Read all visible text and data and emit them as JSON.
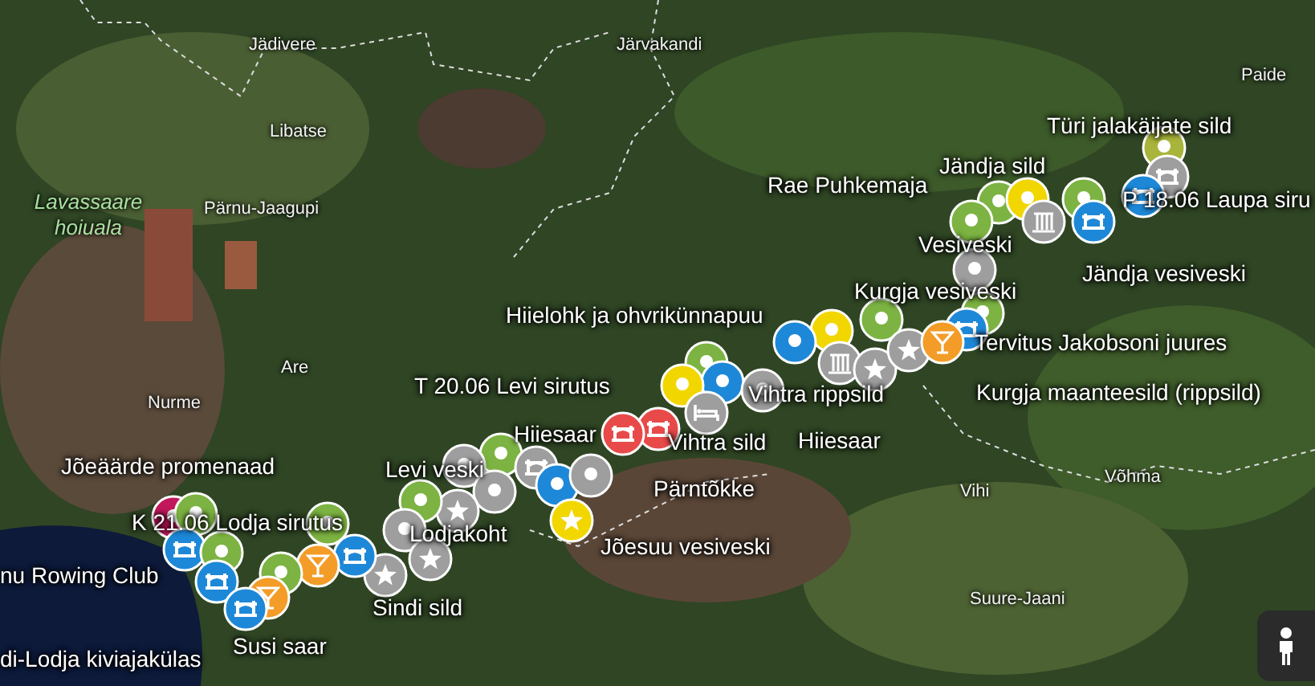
{
  "map": {
    "place_names": [
      {
        "text": "Jädivere",
        "kind": "town"
      },
      {
        "text": "Järvakandi",
        "kind": "town"
      },
      {
        "text": "Paide",
        "kind": "town"
      },
      {
        "text": "Libatse",
        "kind": "town"
      },
      {
        "text": "Lavassaare hoiuala",
        "kind": "area"
      },
      {
        "text": "Pärnu-Jaagupi",
        "kind": "town"
      },
      {
        "text": "Are",
        "kind": "town"
      },
      {
        "text": "Nurme",
        "kind": "town"
      },
      {
        "text": "Vihi",
        "kind": "town"
      },
      {
        "text": "Võhma",
        "kind": "town"
      },
      {
        "text": "Suure-Jaani",
        "kind": "town"
      }
    ],
    "poi_labels": [
      {
        "text": "Türi jalakäijate sild"
      },
      {
        "text": "Rae Puhkemaja"
      },
      {
        "text": "Jändja sild"
      },
      {
        "text": "P 18.06 Laupa siru"
      },
      {
        "text": "Vesiveski"
      },
      {
        "text": "Jändja vesiveski"
      },
      {
        "text": "Kurgja vesiveski"
      },
      {
        "text": "Hiielohk ja ohvrikünnapuu"
      },
      {
        "text": "Tervitus Jakobsoni juures"
      },
      {
        "text": "T 20.06 Levi sirutus"
      },
      {
        "text": "Vihtra rippsild"
      },
      {
        "text": "Kurgja maanteesild (rippsild)"
      },
      {
        "text": "Hiiesaar"
      },
      {
        "text": "Vihtra sild"
      },
      {
        "text": "Hiiesaar"
      },
      {
        "text": "Jõeäärde promenaad"
      },
      {
        "text": "Levi veski"
      },
      {
        "text": "Pärntõkke"
      },
      {
        "text": "K 21.06 Lodja sirutus"
      },
      {
        "text": "Lodjakoht"
      },
      {
        "text": "Jõesuu vesiveski"
      },
      {
        "text": "nu Rowing Club"
      },
      {
        "text": "Sindi sild"
      },
      {
        "text": "Susi saar"
      },
      {
        "text": "di-Lodja kiviajakülas"
      }
    ],
    "markers": [
      {
        "kind": "pin",
        "color": "#a8b43a"
      },
      {
        "kind": "bridge",
        "color": "#9e9e9e"
      },
      {
        "kind": "pin",
        "color": "#7cb342"
      },
      {
        "kind": "pin",
        "color": "#f2d600"
      },
      {
        "kind": "pin",
        "color": "#7cb342"
      },
      {
        "kind": "bridge",
        "color": "#1e88d8"
      },
      {
        "kind": "waterfall",
        "color": "#9e9e9e"
      },
      {
        "kind": "bridge",
        "color": "#1e88d8"
      },
      {
        "kind": "pin",
        "color": "#7cb342"
      },
      {
        "kind": "pin",
        "color": "#9e9e9e"
      },
      {
        "kind": "pin",
        "color": "#7cb342"
      },
      {
        "kind": "bridge",
        "color": "#1e88d8"
      },
      {
        "kind": "pin",
        "color": "#7cb342"
      },
      {
        "kind": "pin",
        "color": "#f2d600"
      },
      {
        "kind": "pin",
        "color": "#1e88d8"
      },
      {
        "kind": "waterfall",
        "color": "#9e9e9e"
      },
      {
        "kind": "star",
        "color": "#9e9e9e"
      },
      {
        "kind": "star",
        "color": "#9e9e9e"
      },
      {
        "kind": "cocktail",
        "color": "#f39c28"
      },
      {
        "kind": "pin",
        "color": "#7cb342"
      },
      {
        "kind": "pin",
        "color": "#1e88d8"
      },
      {
        "kind": "pin",
        "color": "#f2d600"
      },
      {
        "kind": "pin",
        "color": "#9e9e9e"
      },
      {
        "kind": "bed",
        "color": "#9e9e9e"
      },
      {
        "kind": "bridge",
        "color": "#e84a4a"
      },
      {
        "kind": "bridge",
        "color": "#e84a4a"
      },
      {
        "kind": "pin",
        "color": "#7cb342"
      },
      {
        "kind": "pin",
        "color": "#9e9e9e"
      },
      {
        "kind": "bridge",
        "color": "#9e9e9e"
      },
      {
        "kind": "pin",
        "color": "#9e9e9e"
      },
      {
        "kind": "star",
        "color": "#9e9e9e"
      },
      {
        "kind": "pin",
        "color": "#1e88d8"
      },
      {
        "kind": "pin",
        "color": "#9e9e9e"
      },
      {
        "kind": "star",
        "color": "#f2d600"
      },
      {
        "kind": "pin",
        "color": "#7cb342"
      },
      {
        "kind": "pin",
        "color": "#9e9e9e"
      },
      {
        "kind": "star",
        "color": "#9e9e9e"
      },
      {
        "kind": "star",
        "color": "#9e9e9e"
      },
      {
        "kind": "pin",
        "color": "#7cb342"
      },
      {
        "kind": "bridge",
        "color": "#1e88d8"
      },
      {
        "kind": "cocktail",
        "color": "#f39c28"
      },
      {
        "kind": "pin",
        "color": "#c2185b"
      },
      {
        "kind": "pin",
        "color": "#7cb342"
      },
      {
        "kind": "bridge",
        "color": "#1e88d8"
      },
      {
        "kind": "pin",
        "color": "#7cb342"
      },
      {
        "kind": "bridge",
        "color": "#1e88d8"
      },
      {
        "kind": "pin",
        "color": "#7cb342"
      },
      {
        "kind": "cocktail",
        "color": "#f39c28"
      },
      {
        "kind": "bridge",
        "color": "#1e88d8"
      }
    ]
  }
}
